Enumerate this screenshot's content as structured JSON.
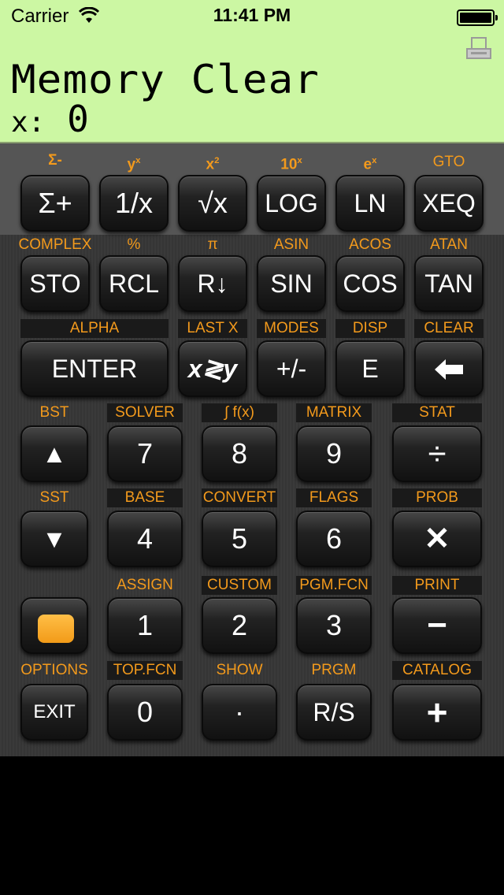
{
  "status": {
    "carrier": "Carrier",
    "time": "11:41 PM"
  },
  "display": {
    "line1": "Memory Clear",
    "x_label": "x:",
    "x_value": "0"
  },
  "row1": {
    "shift": [
      "Σ-",
      "y",
      "x",
      "10",
      "e",
      "GTO"
    ],
    "shift_sup": [
      "",
      "x",
      "2",
      "x",
      "x",
      ""
    ],
    "keys": [
      "Σ+",
      "1/x",
      "√x",
      "LOG",
      "LN",
      "XEQ"
    ]
  },
  "row2": {
    "shift": [
      "COMPLEX",
      "%",
      "π",
      "ASIN",
      "ACOS",
      "ATAN"
    ],
    "keys": [
      "STO",
      "RCL",
      "R↓",
      "SIN",
      "COS",
      "TAN"
    ]
  },
  "row3": {
    "shift": [
      "ALPHA",
      "LAST X",
      "MODES",
      "DISP",
      "CLEAR"
    ],
    "keys": [
      "ENTER",
      "x≷y",
      "+/-",
      "E",
      "⬅"
    ]
  },
  "row4": {
    "shift": [
      "BST",
      "SOLVER",
      "∫ f(x)",
      "MATRIX",
      "STAT"
    ],
    "keys": [
      "▲",
      "7",
      "8",
      "9",
      "÷"
    ]
  },
  "row5": {
    "shift": [
      "SST",
      "BASE",
      "CONVERT",
      "FLAGS",
      "PROB"
    ],
    "keys": [
      "▼",
      "4",
      "5",
      "6",
      "✕"
    ]
  },
  "row6": {
    "shift": [
      "",
      "ASSIGN",
      "CUSTOM",
      "PGM.FCN",
      "PRINT"
    ],
    "keys": [
      "",
      "1",
      "2",
      "3",
      "−"
    ]
  },
  "row7": {
    "shift": [
      "OPTIONS",
      "TOP.FCN",
      "SHOW",
      "PRGM",
      "CATALOG"
    ],
    "keys": [
      "EXIT",
      "0",
      "·",
      "R/S",
      "+"
    ]
  },
  "colors": {
    "lcd": "#ccf7a3",
    "shift_label": "#f39a1c",
    "key": "#1a1a1a",
    "shift_key": "#f7a62a"
  }
}
